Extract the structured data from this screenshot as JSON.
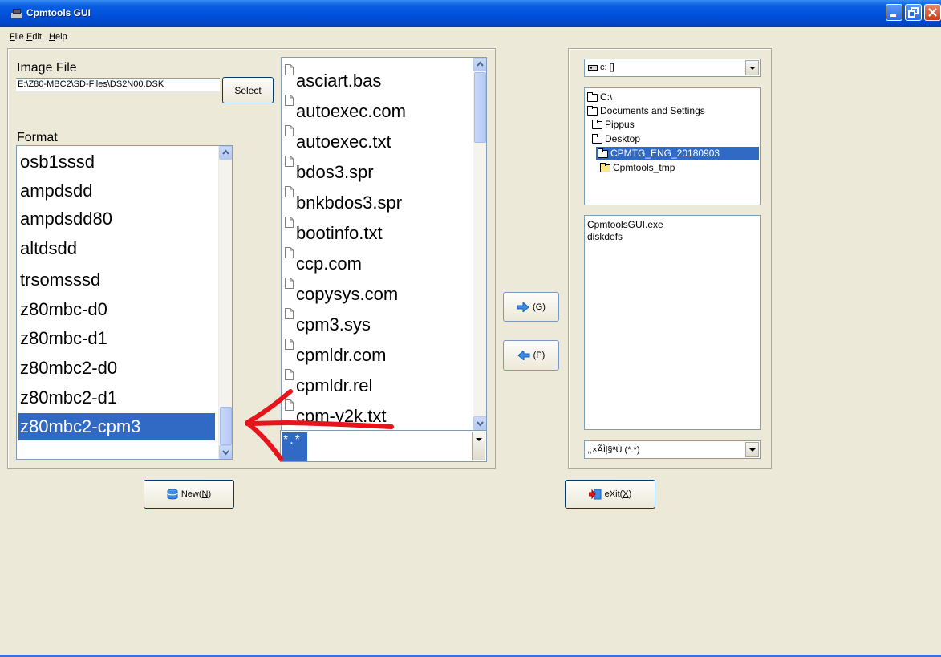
{
  "window": {
    "title": "Cpmtools GUI"
  },
  "menu": {
    "items": [
      {
        "first": "F",
        "rest": "ile"
      },
      {
        "first": "E",
        "rest": "dit"
      },
      {
        "first": "H",
        "rest": "elp"
      }
    ]
  },
  "image_file": {
    "label": "Image File",
    "value": "E:\\Z80-MBC2\\SD-Files\\DS2N00.DSK",
    "select_label": "Select"
  },
  "format": {
    "label": "Format",
    "items": [
      "osb1sssd",
      "ampdsdd",
      "ampdsdd80",
      "altdsdd",
      "trsomsssd",
      "z80mbc-d0",
      "z80mbc-d1",
      "z80mbc2-d0",
      "z80mbc2-d1",
      "z80mbc2-cpm3"
    ],
    "selected": "z80mbc2-cpm3"
  },
  "image_files": {
    "items": [
      "asciart.bas",
      "autoexec.com",
      "autoexec.txt",
      "bdos3.spr",
      "bnkbdos3.spr",
      "bootinfo.txt",
      "ccp.com",
      "copysys.com",
      "cpm3.sys",
      "cpmldr.com",
      "cpmldr.rel",
      "cpm-y2k.txt"
    ],
    "filter_value": "*.*"
  },
  "transfer": {
    "get_label": "(G)",
    "put_label": "(P)"
  },
  "local": {
    "drive": "c: []",
    "tree": [
      "C:\\",
      "Documents and Settings",
      "Pippus",
      "Desktop",
      "CPMTG_ENG_20180903",
      "Cpmtools_tmp"
    ],
    "selected_folder": "CPMTG_ENG_20180903",
    "files": [
      "CpmtoolsGUI.exe",
      "diskdefs"
    ],
    "filter": ",;×ÃÌļ§ªÙ (*.*)"
  },
  "buttons": {
    "new_prefix": "New(",
    "new_key": "N",
    "new_suffix": ")",
    "exit_prefix": "eXit(",
    "exit_key": "X",
    "exit_suffix": ")"
  },
  "colors": {
    "selection": "#316ac5",
    "titlebar": "#0050dc",
    "annotation_arrow": "#e8141c"
  },
  "icons": [
    "window-icon",
    "minimize-icon",
    "maximize-icon",
    "close-icon",
    "document-icon",
    "right-arrow-icon",
    "left-arrow-icon",
    "drive-icon",
    "folder-icon",
    "database-icon",
    "exit-door-icon"
  ]
}
